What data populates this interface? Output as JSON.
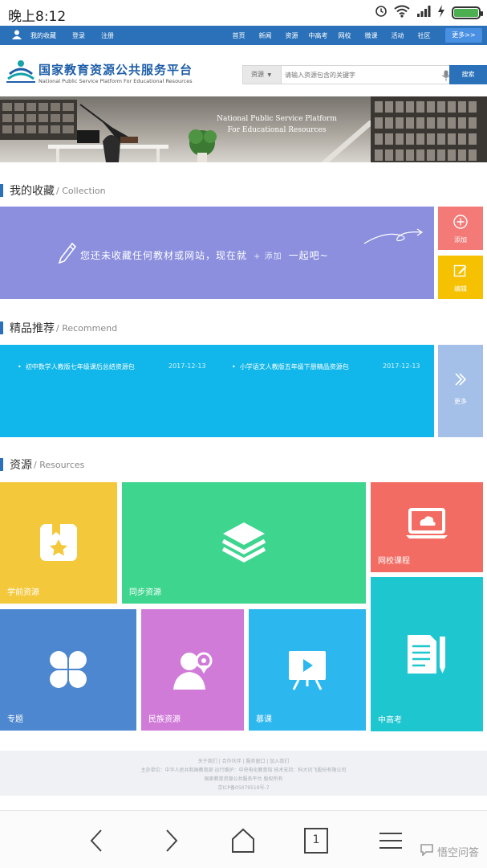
{
  "status": {
    "time": "晚上8:12"
  },
  "topnav": {
    "my_collection": "我的收藏",
    "login": "登录",
    "register": "注册",
    "items": [
      "首页",
      "新闻",
      "资源",
      "中高考",
      "网校",
      "微课",
      "活动",
      "社区"
    ],
    "more": "更多>>"
  },
  "header": {
    "title": "国家教育资源公共服务平台",
    "subtitle": "National Public Service Platform For Educational Resources"
  },
  "search": {
    "type": "资源",
    "placeholder": "请输入资源包含的关键字",
    "button": "搜索"
  },
  "banner": {
    "line1": "National Public Service Platform",
    "line2": "For Educational Resources"
  },
  "collection": {
    "title": "我的收藏",
    "title_en": "/ Collection",
    "message_before": "您还未收藏任何教材或网站，现在就",
    "add_link": "+ 添加",
    "message_after": "一起吧~",
    "add_button": "添加",
    "edit_button": "编辑"
  },
  "recommend": {
    "title": "精品推荐",
    "title_en": "/ Recommend",
    "items": [
      {
        "text": "初中数学人教版七年级课后总结资源包",
        "date": "2017-12-13"
      },
      {
        "text": "小学语文人教版五年级下册精品资源包",
        "date": "2017-12-13"
      }
    ],
    "more": "更多"
  },
  "resources": {
    "title": "资源",
    "title_en": "/ Resources",
    "tiles": [
      {
        "label": "学前资源",
        "color": "#f4c83b",
        "icon": "bookmark-star-icon"
      },
      {
        "label": "同步资源",
        "color": "#3ed58f",
        "icon": "layers-icon"
      },
      {
        "label": "网校课程",
        "color": "#f36c63",
        "icon": "laptop-cloud-icon"
      },
      {
        "label": "专题",
        "color": "#4d87cf",
        "icon": "clover-icon"
      },
      {
        "label": "民族资源",
        "color": "#d17bd9",
        "icon": "person-location-icon"
      },
      {
        "label": "慕课",
        "color": "#2cb7ee",
        "icon": "video-board-icon"
      },
      {
        "label": "中高考",
        "color": "#1ec6cf",
        "icon": "document-pen-icon"
      }
    ]
  },
  "footer": {
    "line1": "关于我们 | 合作伙伴 | 服务窗口 | 加入我们",
    "line2": "主办单位：中华人民共和国教育部 运行维护：中央电化教育馆 技术支持：科大讯飞股份有限公司",
    "line3": "国家教育资源公共服务平台 版权所有",
    "line4": "京ICP备05079519号-7"
  },
  "bottombar": {
    "tab_count": "1",
    "watermark": "悟空问答"
  }
}
